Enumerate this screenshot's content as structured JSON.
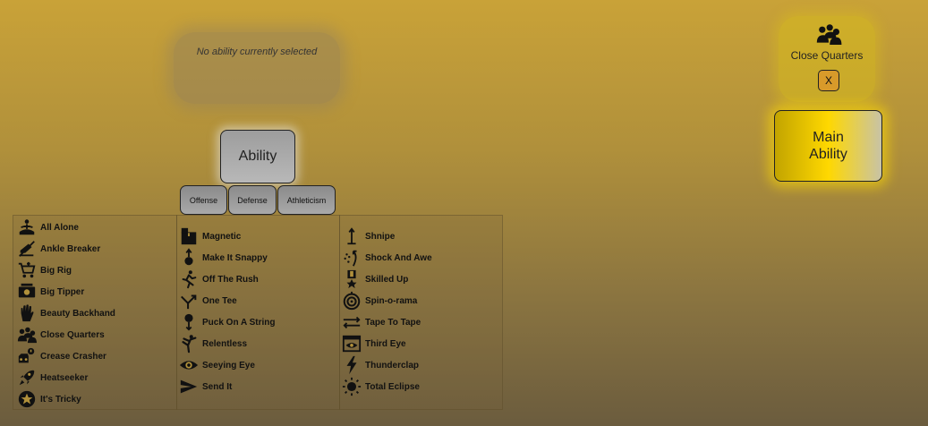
{
  "selection_panel": {
    "empty_text": "No ability currently selected"
  },
  "ability_button": {
    "label": "Ability"
  },
  "categories": [
    {
      "label": "Offense"
    },
    {
      "label": "Defense"
    },
    {
      "label": "Athleticism"
    }
  ],
  "abilities": {
    "column1": [
      {
        "label": "All Alone",
        "icon": "meditation-icon"
      },
      {
        "label": "Ankle Breaker",
        "icon": "skate-broken-icon"
      },
      {
        "label": "Big Rig",
        "icon": "shopping-cart-icon"
      },
      {
        "label": "Big Tipper",
        "icon": "money-icon"
      },
      {
        "label": "Beauty Backhand",
        "icon": "hand-icon"
      },
      {
        "label": "Close Quarters",
        "icon": "group-icon"
      },
      {
        "label": "Crease Crasher",
        "icon": "car-crash-icon"
      },
      {
        "label": "Heatseeker",
        "icon": "rocket-icon"
      },
      {
        "label": "It's Tricky",
        "icon": "star-circle-icon"
      }
    ],
    "column2": [
      {
        "label": "Magnetic",
        "icon": "magnet-icon"
      },
      {
        "label": "Make It Snappy",
        "icon": "snap-icon"
      },
      {
        "label": "Off The Rush",
        "icon": "runner-icon"
      },
      {
        "label": "One Tee",
        "icon": "merge-arrow-icon"
      },
      {
        "label": "Puck On A String",
        "icon": "puck-string-icon"
      },
      {
        "label": "Relentless",
        "icon": "kick-icon"
      },
      {
        "label": "Seeying Eye",
        "icon": "eye-icon"
      },
      {
        "label": "Send It",
        "icon": "send-icon"
      }
    ],
    "column3": [
      {
        "label": "Shnipe",
        "icon": "shot-arrow-icon"
      },
      {
        "label": "Shock And Awe",
        "icon": "sparkle-icon"
      },
      {
        "label": "Skilled Up",
        "icon": "medal-icon"
      },
      {
        "label": "Spin-o-rama",
        "icon": "spiral-icon"
      },
      {
        "label": "Tape To Tape",
        "icon": "swap-arrows-icon"
      },
      {
        "label": "Third Eye",
        "icon": "eye-box-icon"
      },
      {
        "label": "Thunderclap",
        "icon": "lightning-icon"
      },
      {
        "label": "Total Eclipse",
        "icon": "sun-icon"
      }
    ]
  },
  "selected_card": {
    "title": "Close Quarters",
    "close_label": "X",
    "icon": "group-icon"
  },
  "main_ability": {
    "line1": "Main",
    "line2": "Ability"
  },
  "colors": {
    "accent_gold": "#ffd800",
    "close_button": "#d89a2a"
  }
}
